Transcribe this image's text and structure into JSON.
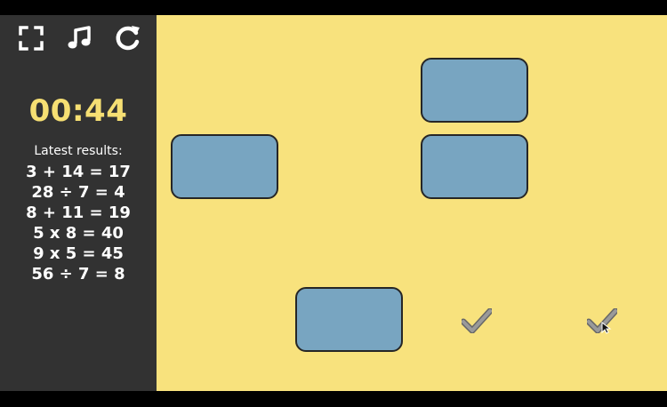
{
  "controls": {
    "fullscreen_icon": "fullscreen-icon",
    "music_icon": "music-icon",
    "restart_icon": "restart-icon"
  },
  "timer": {
    "value": "00:44"
  },
  "results": {
    "title": "Latest results:",
    "items": [
      "3 + 14 = 17",
      "28 ÷ 7 = 4",
      "8 + 11 = 19",
      "5 x 8 = 40",
      "9 x 5 = 45",
      "56 ÷ 7 = 8"
    ]
  },
  "colors": {
    "sidebar": "#323232",
    "board": "#f8e27d",
    "timer": "#f6df73",
    "tile": "#78a5c1",
    "tile_border": "#262626",
    "check": "#8f8f8f"
  }
}
